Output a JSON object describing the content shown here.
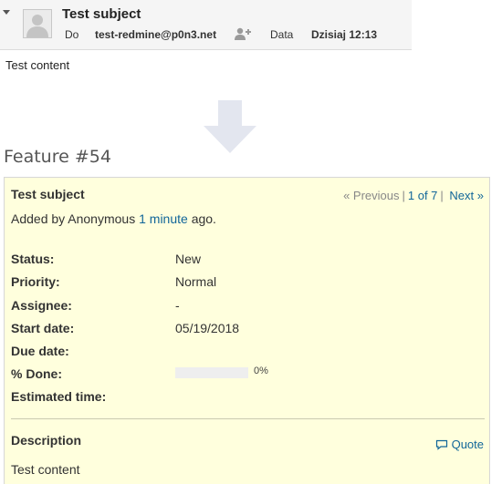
{
  "email": {
    "subject": "Test subject",
    "to_label": "Do",
    "to_address": "test-redmine@p0n3.net",
    "date_label": "Data",
    "date_value": "Dzisiaj 12:13",
    "body": "Test content"
  },
  "issue": {
    "title": "Feature #54",
    "subject": "Test subject",
    "nav": {
      "previous": "« Previous",
      "position": "1 of 7",
      "next": "Next »"
    },
    "added_by": {
      "prefix": "Added by Anonymous ",
      "time_link": "1 minute",
      "suffix": " ago."
    },
    "attributes": {
      "status_label": "Status:",
      "status_value": "New",
      "priority_label": "Priority:",
      "priority_value": "Normal",
      "assignee_label": "Assignee:",
      "assignee_value": "-",
      "start_date_label": "Start date:",
      "start_date_value": "05/19/2018",
      "due_date_label": "Due date:",
      "done_label": "% Done:",
      "done_text": "0%",
      "done_fraction": 0,
      "estimated_label": "Estimated time:"
    },
    "description_label": "Description",
    "quote_label": "Quote",
    "description_text": "Test content"
  },
  "colors": {
    "link": "#116699",
    "issue_background": "#ffffdd",
    "arrow": "#e3e6ef"
  },
  "icons": {
    "collapse": "caret-down-icon",
    "avatar": "user-silhouette-icon",
    "add_contact": "add-person-icon",
    "flow": "down-arrow-icon",
    "quote": "speech-bubble-icon"
  }
}
